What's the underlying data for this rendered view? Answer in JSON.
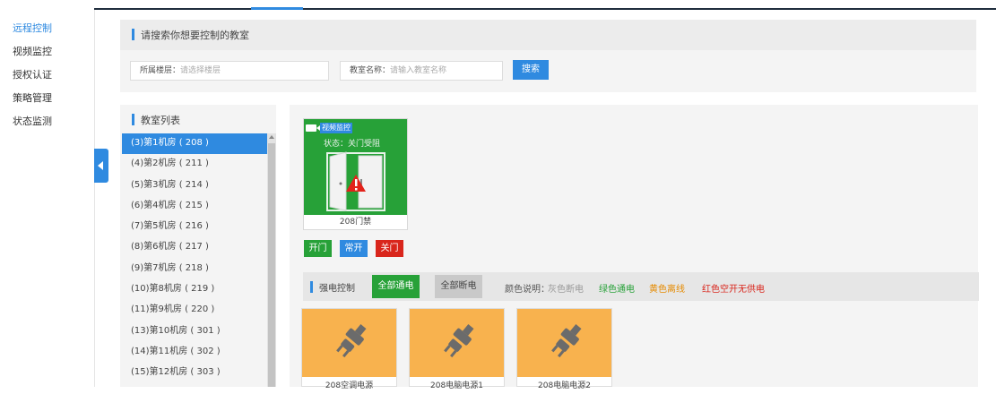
{
  "nav": {
    "items": [
      {
        "label": "远程控制",
        "active": true
      },
      {
        "label": "视频监控",
        "active": false
      },
      {
        "label": "授权认证",
        "active": false
      },
      {
        "label": "策略管理",
        "active": false
      },
      {
        "label": "状态监测",
        "active": false
      }
    ]
  },
  "search": {
    "header": "请搜索你想要控制的教室",
    "floor_label": "所属楼层：",
    "floor_placeholder": "请选择楼层",
    "room_label": "教室名称：",
    "room_placeholder": "请输入教室名称",
    "button": "搜索"
  },
  "room_list": {
    "title": "教室列表",
    "items": [
      "(3)第1机房 ( 208 )",
      "(4)第2机房 ( 211 )",
      "(5)第3机房 ( 214 )",
      "(6)第4机房 ( 215 )",
      "(7)第5机房 ( 216 )",
      "(8)第6机房 ( 217 )",
      "(9)第7机房 ( 218 )",
      "(10)第8机房 ( 219 )",
      "(11)第9机房 ( 220 )",
      "(13)第10机房 ( 301 )",
      "(14)第11机房 ( 302 )",
      "(15)第12机房 ( 303 )"
    ],
    "selected_index": 0
  },
  "door": {
    "video_tag": "视频监控",
    "status": "状态：关门受阻",
    "name": "208门禁",
    "btn_open": "开门",
    "btn_always_open": "常开",
    "btn_close": "关门"
  },
  "power": {
    "title": "强电控制",
    "btn_all_on": "全部通电",
    "btn_all_off": "全部断电",
    "legend_label": "颜色说明：",
    "legend": [
      {
        "text": "灰色断电",
        "color": "#9a9a9a"
      },
      {
        "text": "绿色通电",
        "color": "#27a138"
      },
      {
        "text": "黄色离线",
        "color": "#e58a00"
      },
      {
        "text": "红色空开无供电",
        "color": "#d9261c"
      }
    ],
    "devices": [
      {
        "name": "208空调电源"
      },
      {
        "name": "208电脑电源1"
      },
      {
        "name": "208电脑电源2"
      }
    ]
  },
  "colors": {
    "accent": "#2f8ae0",
    "green": "#27a138",
    "red": "#d9261c",
    "offline": "#f8b24e"
  }
}
